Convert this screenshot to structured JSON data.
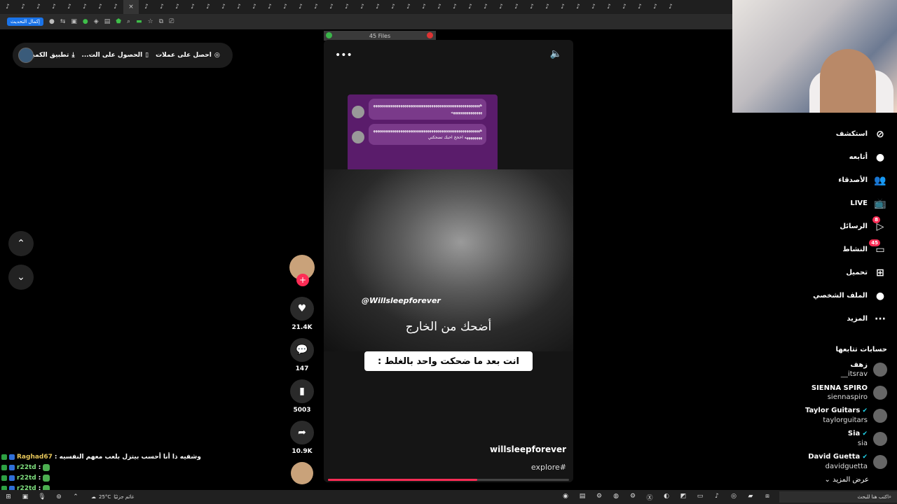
{
  "browser": {
    "tab_count": 44,
    "finish_update_label": "إكمال التحديث"
  },
  "topbar": {
    "get_coins": "احصل على عملات",
    "get_app": "الحصول على الت...",
    "desktop_app": "تطبيق الكمبيوتر"
  },
  "file_bar": {
    "label": "45 Files"
  },
  "video": {
    "chat_bubbles": [
      "هههههههههههههههههههههههههههههههههههههههههههههههههههههههههههههههههههههههه",
      "ههههههههههههههههههههههههههههههههههههههههههههههههههههههههههههههههه اخخخ احبك تضحكني"
    ],
    "watermark_handle": "@Willsleepforever",
    "caption_top": "أضحك من الخارج",
    "caption_box": "انت بعد ما ضحكت واحد بالغلط :",
    "author": "willsleepforever",
    "hashtag": "explore#",
    "progress": 0.62
  },
  "actions": {
    "likes": "21.4K",
    "comments": "147",
    "saves": "5003",
    "shares": "10.9K"
  },
  "sidebar": {
    "nav": [
      {
        "label": "استكشف",
        "icon": "compass-icon",
        "glyph": "⊘"
      },
      {
        "label": "أتابعه",
        "icon": "following-avatar-icon",
        "glyph": "●"
      },
      {
        "label": "الأصدقاء",
        "icon": "friends-icon",
        "glyph": "👥"
      },
      {
        "label": "LIVE",
        "icon": "live-tv-icon",
        "glyph": "📺"
      },
      {
        "label": "الرسائل",
        "icon": "send-icon",
        "glyph": "▷",
        "badge": "8"
      },
      {
        "label": "النشاط",
        "icon": "inbox-icon",
        "glyph": "▭",
        "badge": "45"
      },
      {
        "label": "تحميل",
        "icon": "upload-icon",
        "glyph": "⊞"
      },
      {
        "label": "الملف الشخصي",
        "icon": "profile-avatar-icon",
        "glyph": "●"
      },
      {
        "label": "المزيد",
        "icon": "more-icon",
        "glyph": "···"
      }
    ],
    "following_title": "حسابات تتابعها",
    "accounts": [
      {
        "name": "زهف",
        "user": "__itsrav",
        "verified": false
      },
      {
        "name": "SIENNA SPIRO",
        "user": "siennaspiro",
        "verified": false
      },
      {
        "name": "Taylor Guitars",
        "user": "taylorguitars",
        "verified": true
      },
      {
        "name": "Sia",
        "user": "sia",
        "verified": true
      },
      {
        "name": "David Guetta",
        "user": "davidguetta",
        "verified": true
      }
    ],
    "see_more": "عرض المزيد"
  },
  "stream_chat": [
    {
      "user": "Raghad67",
      "message": ": وشفيه ذا أنا أحسب بيتزل بلعب معهم النفسيه"
    },
    {
      "user": "r22td",
      "message": ":"
    },
    {
      "user": "r22td",
      "message": ":"
    },
    {
      "user": "r22td",
      "message": ":"
    }
  ],
  "taskbar": {
    "temperature": "25°C",
    "weather_label": "غائم جزئيًا",
    "search_placeholder": "اكتب هنا للبحث"
  }
}
